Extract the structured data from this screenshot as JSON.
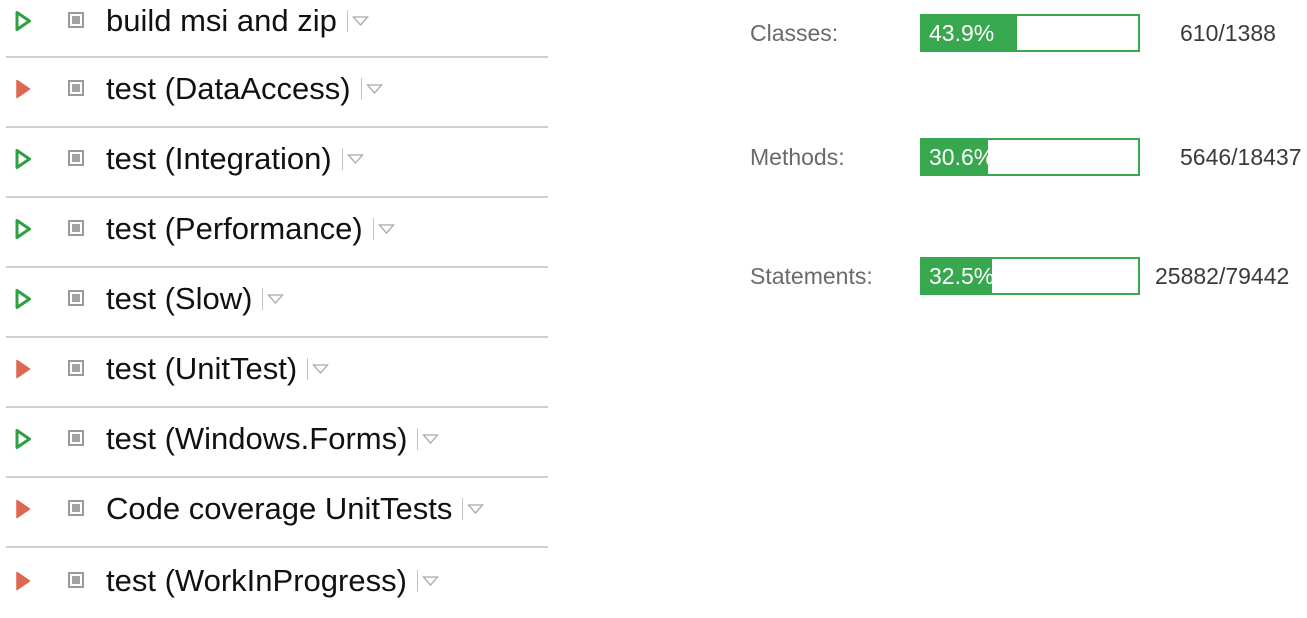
{
  "builds": [
    {
      "name": "build msi and zip",
      "status": "success",
      "status_icon": "run-outline-green-icon"
    },
    {
      "name": "test (DataAccess)",
      "status": "failed",
      "status_icon": "run-filled-red-icon"
    },
    {
      "name": "test (Integration)",
      "status": "success",
      "status_icon": "run-outline-green-icon"
    },
    {
      "name": "test (Performance)",
      "status": "success",
      "status_icon": "run-outline-green-icon"
    },
    {
      "name": "test (Slow)",
      "status": "success",
      "status_icon": "run-outline-green-icon"
    },
    {
      "name": "test (UnitTest)",
      "status": "failed",
      "status_icon": "run-filled-red-icon"
    },
    {
      "name": "test (Windows.Forms)",
      "status": "success",
      "status_icon": "run-outline-green-icon"
    },
    {
      "name": "Code coverage UnitTests",
      "status": "failed",
      "status_icon": "run-filled-red-icon"
    },
    {
      "name": "test (WorkInProgress)",
      "status": "failed",
      "status_icon": "run-filled-red-icon"
    }
  ],
  "coverage": {
    "classes": {
      "label": "Classes:",
      "percent": "43.9%",
      "fraction": 0.439,
      "ratio": "610/1388"
    },
    "methods": {
      "label": "Methods:",
      "percent": "30.6%",
      "fraction": 0.306,
      "ratio": "5646/18437"
    },
    "statements": {
      "label": "Statements:",
      "percent": "32.5%",
      "fraction": 0.325,
      "ratio": "25882/79442"
    }
  },
  "colors": {
    "success": "#2ea043",
    "failed": "#e0674f",
    "coverage_bar": "#38a84e"
  }
}
